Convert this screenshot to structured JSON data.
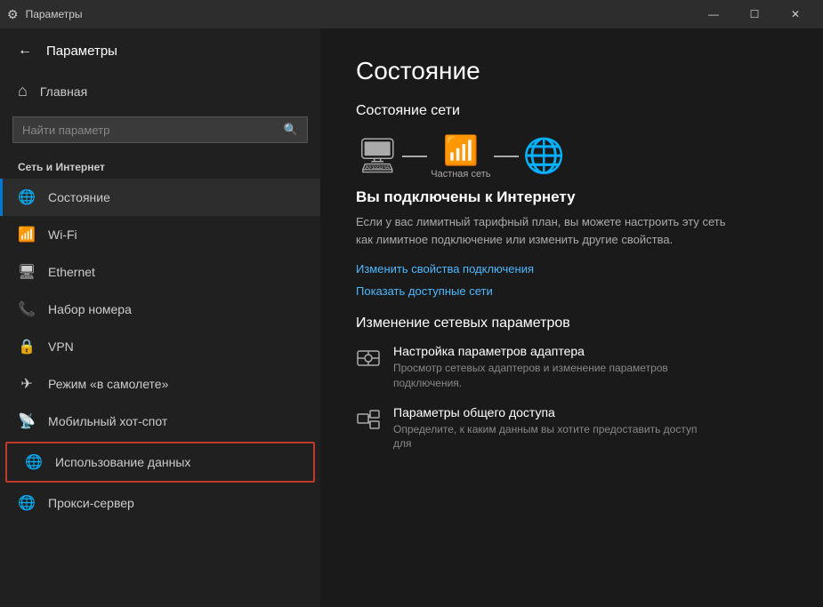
{
  "titlebar": {
    "title": "Параметры",
    "minimize": "—",
    "maximize": "☐",
    "close": "✕"
  },
  "sidebar": {
    "back_button": "←",
    "title": "Параметры",
    "home_label": "Главная",
    "search_placeholder": "Найти параметр",
    "section_label": "Сеть и Интернет",
    "nav_items": [
      {
        "id": "status",
        "label": "Состояние",
        "icon": "🌐",
        "active": true
      },
      {
        "id": "wifi",
        "label": "Wi-Fi",
        "icon": "📶"
      },
      {
        "id": "ethernet",
        "label": "Ethernet",
        "icon": "🖥"
      },
      {
        "id": "dialup",
        "label": "Набор номера",
        "icon": "📞"
      },
      {
        "id": "vpn",
        "label": "VPN",
        "icon": "🔒"
      },
      {
        "id": "airplane",
        "label": "Режим «в самолете»",
        "icon": "✈"
      },
      {
        "id": "hotspot",
        "label": "Мобильный хот-спот",
        "icon": "📡"
      },
      {
        "id": "datausage",
        "label": "Использование данных",
        "icon": "🌐",
        "highlighted": true
      },
      {
        "id": "proxy",
        "label": "Прокси-сервер",
        "icon": "🌐"
      }
    ]
  },
  "main": {
    "page_title": "Состояние",
    "network_status_heading": "Состояние сети",
    "network_label": "Частная сеть",
    "connected_title": "Вы подключены к Интернету",
    "connected_desc": "Если у вас лимитный тарифный план, вы можете настроить эту сеть как лимитное подключение или изменить другие свойства.",
    "link_properties": "Изменить свойства подключения",
    "link_available": "Показать доступные сети",
    "change_settings_heading": "Изменение сетевых параметров",
    "settings_items": [
      {
        "id": "adapter",
        "icon": "⚙",
        "title": "Настройка параметров адаптера",
        "desc": "Просмотр сетевых адаптеров и изменение параметров подключения."
      },
      {
        "id": "sharing",
        "icon": "🖨",
        "title": "Параметры общего доступа",
        "desc": "Определите, к каким данным вы хотите предоставить доступ для"
      }
    ]
  }
}
